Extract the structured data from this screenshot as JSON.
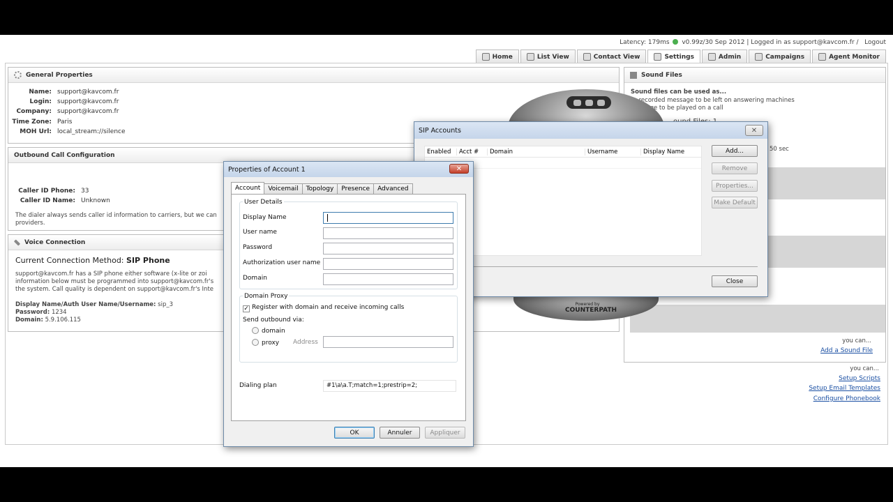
{
  "topbar": {
    "latency": "Latency: 179ms",
    "version": "v0.99z/30 Sep 2012 | Logged in as support@kavcom.fr /",
    "logout": "Logout"
  },
  "nav": {
    "tabs": [
      {
        "label": "Home",
        "icon": "home-icon"
      },
      {
        "label": "List View",
        "icon": "list-icon"
      },
      {
        "label": "Contact View",
        "icon": "contact-icon"
      },
      {
        "label": "Settings",
        "icon": "gear-icon"
      },
      {
        "label": "Admin",
        "icon": "admin-icon"
      },
      {
        "label": "Campaigns",
        "icon": "campaigns-icon"
      },
      {
        "label": "Agent Monitor",
        "icon": "monitor-icon"
      }
    ],
    "active": "Settings"
  },
  "general": {
    "title": "General Properties",
    "name_label": "Name:",
    "name": "support@kavcom.fr",
    "login_label": "Login:",
    "login": "support@kavcom.fr",
    "company_label": "Company:",
    "company": "support@kavcom.fr",
    "tz_label": "Time Zone:",
    "tz": "Paris",
    "moh_label": "MOH Url:",
    "moh": "local_stream://silence"
  },
  "outbound": {
    "title": "Outbound Call Configuration",
    "callerid_phone_label": "Caller ID Phone:",
    "callerid_phone": "33",
    "callerid_name_label": "Caller ID Name:",
    "callerid_name": "Unknown",
    "note1": "The dialer always sends caller id information to carriers, but we can",
    "note2": "providers."
  },
  "voice": {
    "title": "Voice Connection",
    "method_label": "Current Connection Method:",
    "method": "SIP Phone",
    "desc1": "support@kavcom.fr has a SIP phone either software (x-lite or zoi",
    "desc2": "information below must be programmed into support@kavcom.fr's",
    "desc3": "the system. Call quality is dependent on support@kavcom.fr's Inte",
    "creds_label": "Display Name/Auth User Name/Username:",
    "creds": "sip_3",
    "password_label": "Password:",
    "password": "1234",
    "domain_label": "Domain:",
    "domain": "5.9.106.115"
  },
  "sound": {
    "title": "Sound Files",
    "intro": "Sound files can be used as...",
    "line1": "re-recorded message to be left on answering machines",
    "line2": "message to be played on a call",
    "count": "ound Files: 1",
    "sec": "50 sec",
    "you_can": "you can...",
    "add_link": "Add a Sound File"
  },
  "links": {
    "you_can": "you can...",
    "setup_scripts": "Setup Scripts",
    "setup_email": "Setup Email Templates",
    "configure_phonebook": "Configure Phonebook"
  },
  "sip_window": {
    "title": "SIP Accounts",
    "columns": [
      "Enabled",
      "Acct #",
      "Domain",
      "Username",
      "Display Name"
    ],
    "add": "Add...",
    "remove": "Remove",
    "properties": "Properties...",
    "make_default": "Make Default",
    "close": "Close"
  },
  "phone": {
    "brand_small": "Powered by",
    "brand": "COUNTERPATH"
  },
  "props_window": {
    "title": "Properties of Account 1",
    "tabs": [
      "Account",
      "Voicemail",
      "Topology",
      "Presence",
      "Advanced"
    ],
    "active_tab": "Account",
    "user_details": "User Details",
    "display_name_label": "Display Name",
    "display_name": "",
    "user_name_label": "User name",
    "user_name": "",
    "password_label": "Password",
    "password": "",
    "auth_label": "Authorization user name",
    "auth": "",
    "domain_label": "Domain",
    "domain": "",
    "domain_proxy": "Domain Proxy",
    "register_label": "Register with domain and receive incoming calls",
    "register_checked": true,
    "send_outbound": "Send outbound via:",
    "opt_domain": "domain",
    "opt_proxy": "proxy",
    "address_label": "Address",
    "address": "",
    "dialing_plan_label": "Dialing plan",
    "dialing_plan": "#1\\a\\a.T;match=1;prestrip=2;",
    "ok": "OK",
    "cancel": "Annuler",
    "apply": "Appliquer"
  }
}
